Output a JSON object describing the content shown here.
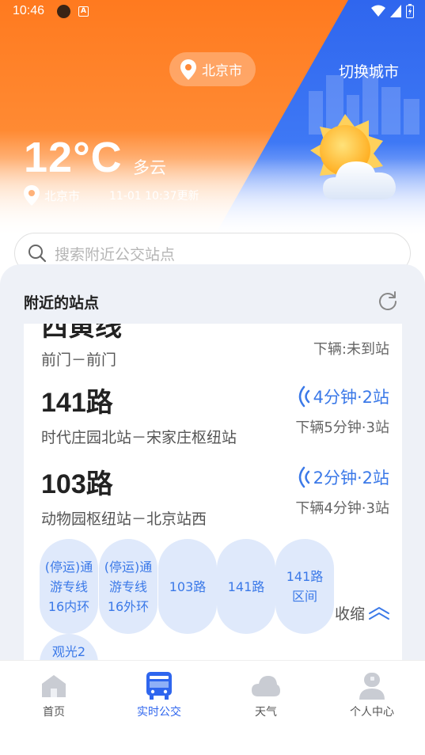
{
  "status_bar": {
    "time": "10:46",
    "notif_label": "A"
  },
  "header": {
    "location_pill": "北京市",
    "switch_city": "切换城市",
    "temperature": "12°C",
    "condition": "多云",
    "sub_location": "北京市",
    "update_time": "11-01 10:37更新"
  },
  "search": {
    "placeholder": "搜索附近公交站点"
  },
  "nearby": {
    "title": "附近的站点",
    "routes": [
      {
        "name": "西黄线",
        "direction": "前门－前门",
        "eta": "",
        "next": "下辆:未到站"
      },
      {
        "name": "141路",
        "direction": "时代庄园北站－宋家庄枢纽站",
        "eta": "4分钟·2站",
        "next": "下辆5分钟·3站"
      },
      {
        "name": "103路",
        "direction": "动物园枢纽站－北京站西",
        "eta": "2分钟·2站",
        "next": "下辆4分钟·3站"
      }
    ],
    "chips": [
      "(停运)通游专线16内环",
      "(停运)通游专线16外环",
      "103路",
      "141路",
      "141路区间",
      "观光2"
    ],
    "collapse_label": "收缩"
  },
  "bottom_nav": {
    "items": [
      {
        "label": "首页",
        "icon": "home-icon"
      },
      {
        "label": "实时公交",
        "icon": "bus-icon"
      },
      {
        "label": "天气",
        "icon": "cloud-icon"
      },
      {
        "label": "个人中心",
        "icon": "user-icon"
      }
    ],
    "active_index": 1
  },
  "colors": {
    "orange": "#ff7a1f",
    "blue": "#2f66ee",
    "accent_text": "#3b79e8",
    "chip_bg": "#dfe9fb",
    "panel_bg": "#eef1f7"
  }
}
